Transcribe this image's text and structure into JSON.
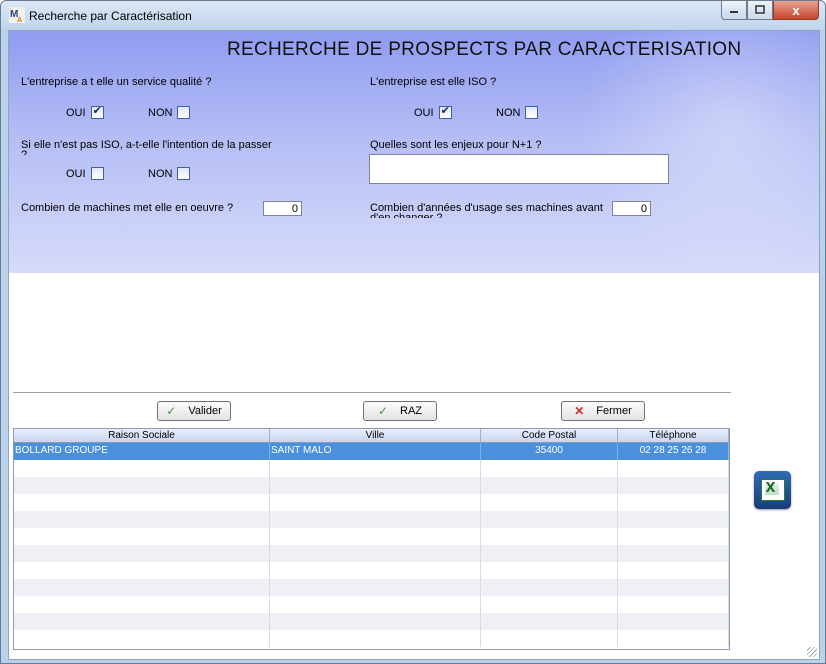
{
  "window": {
    "title": "Recherche par Caractérisation",
    "close_glyph": "x"
  },
  "form": {
    "heading": "RECHERCHE DE PROSPECTS PAR CARACTERISATION",
    "q_service_qualite": "L'entreprise a t elle un service qualité ?",
    "q_iso": "L'entreprise est elle ISO ?",
    "q_intention_line1": "Si elle n'est pas ISO, a-t-elle l'intention de la passer",
    "q_intention_line2": "?",
    "q_enjeux": "Quelles sont les enjeux pour N+1 ?",
    "q_machines": "Combien de machines met elle en oeuvre ?",
    "q_annees_line1": "Combien d'années d'usage ses machines avant",
    "q_annees_line2": "d'en changer ?",
    "oui_label": "OUI",
    "non_label": "NON",
    "machines_value": "0",
    "annees_value": "0",
    "enjeux_value": "",
    "service_qualite": {
      "oui": true,
      "non": false
    },
    "iso": {
      "oui": true,
      "non": false
    },
    "intention": {
      "oui": false,
      "non": false
    }
  },
  "buttons": {
    "valider": "Valider",
    "raz": "RAZ",
    "fermer": "Fermer"
  },
  "grid": {
    "columns": [
      "Raison Sociale",
      "Ville",
      "Code Postal",
      "Téléphone"
    ],
    "rows": [
      {
        "raison_sociale": "BOLLARD GROUPE",
        "ville": "SAINT MALO",
        "code_postal": "35400",
        "telephone": "02 28 25 26 28"
      }
    ]
  },
  "icons": {
    "app": "app-icon",
    "excel": "excel-export-icon"
  },
  "colors": {
    "selection": "#4a90dc",
    "panel_top": "#8f9cf0",
    "panel_bottom": "#d7dbfa"
  }
}
